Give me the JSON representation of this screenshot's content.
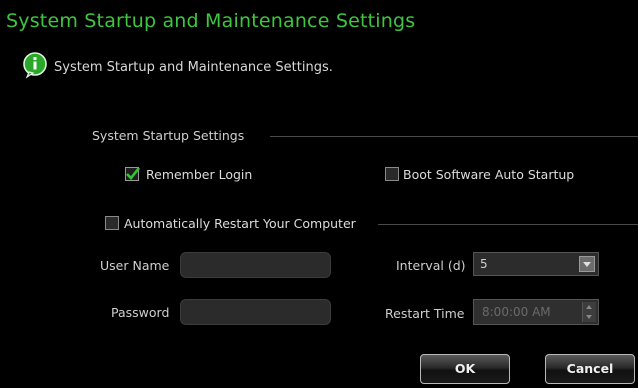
{
  "dialog": {
    "title": "System Startup and Maintenance Settings",
    "info_text": "System Startup and Maintenance Settings."
  },
  "startup_group": {
    "label": "System Startup Settings",
    "remember_login": {
      "label": "Remember Login",
      "checked": true
    },
    "boot_auto_startup": {
      "label": "Boot Software Auto Startup",
      "checked": false
    }
  },
  "restart_group": {
    "label": "Automatically Restart Your Computer",
    "checked": false,
    "user_name": {
      "label": "User Name",
      "value": ""
    },
    "password": {
      "label": "Password",
      "value": ""
    },
    "interval": {
      "label": "Interval (d)",
      "value": "5"
    },
    "restart_time": {
      "label": "Restart Time",
      "value": "8:00:00 AM"
    }
  },
  "buttons": {
    "ok": "OK",
    "cancel": "Cancel"
  },
  "colors": {
    "title": "#3ec63e",
    "checkmark": "#34c534",
    "background": "#000000"
  },
  "icons": {
    "info": "speech-bubble-info-icon",
    "check": "checkmark-icon"
  }
}
